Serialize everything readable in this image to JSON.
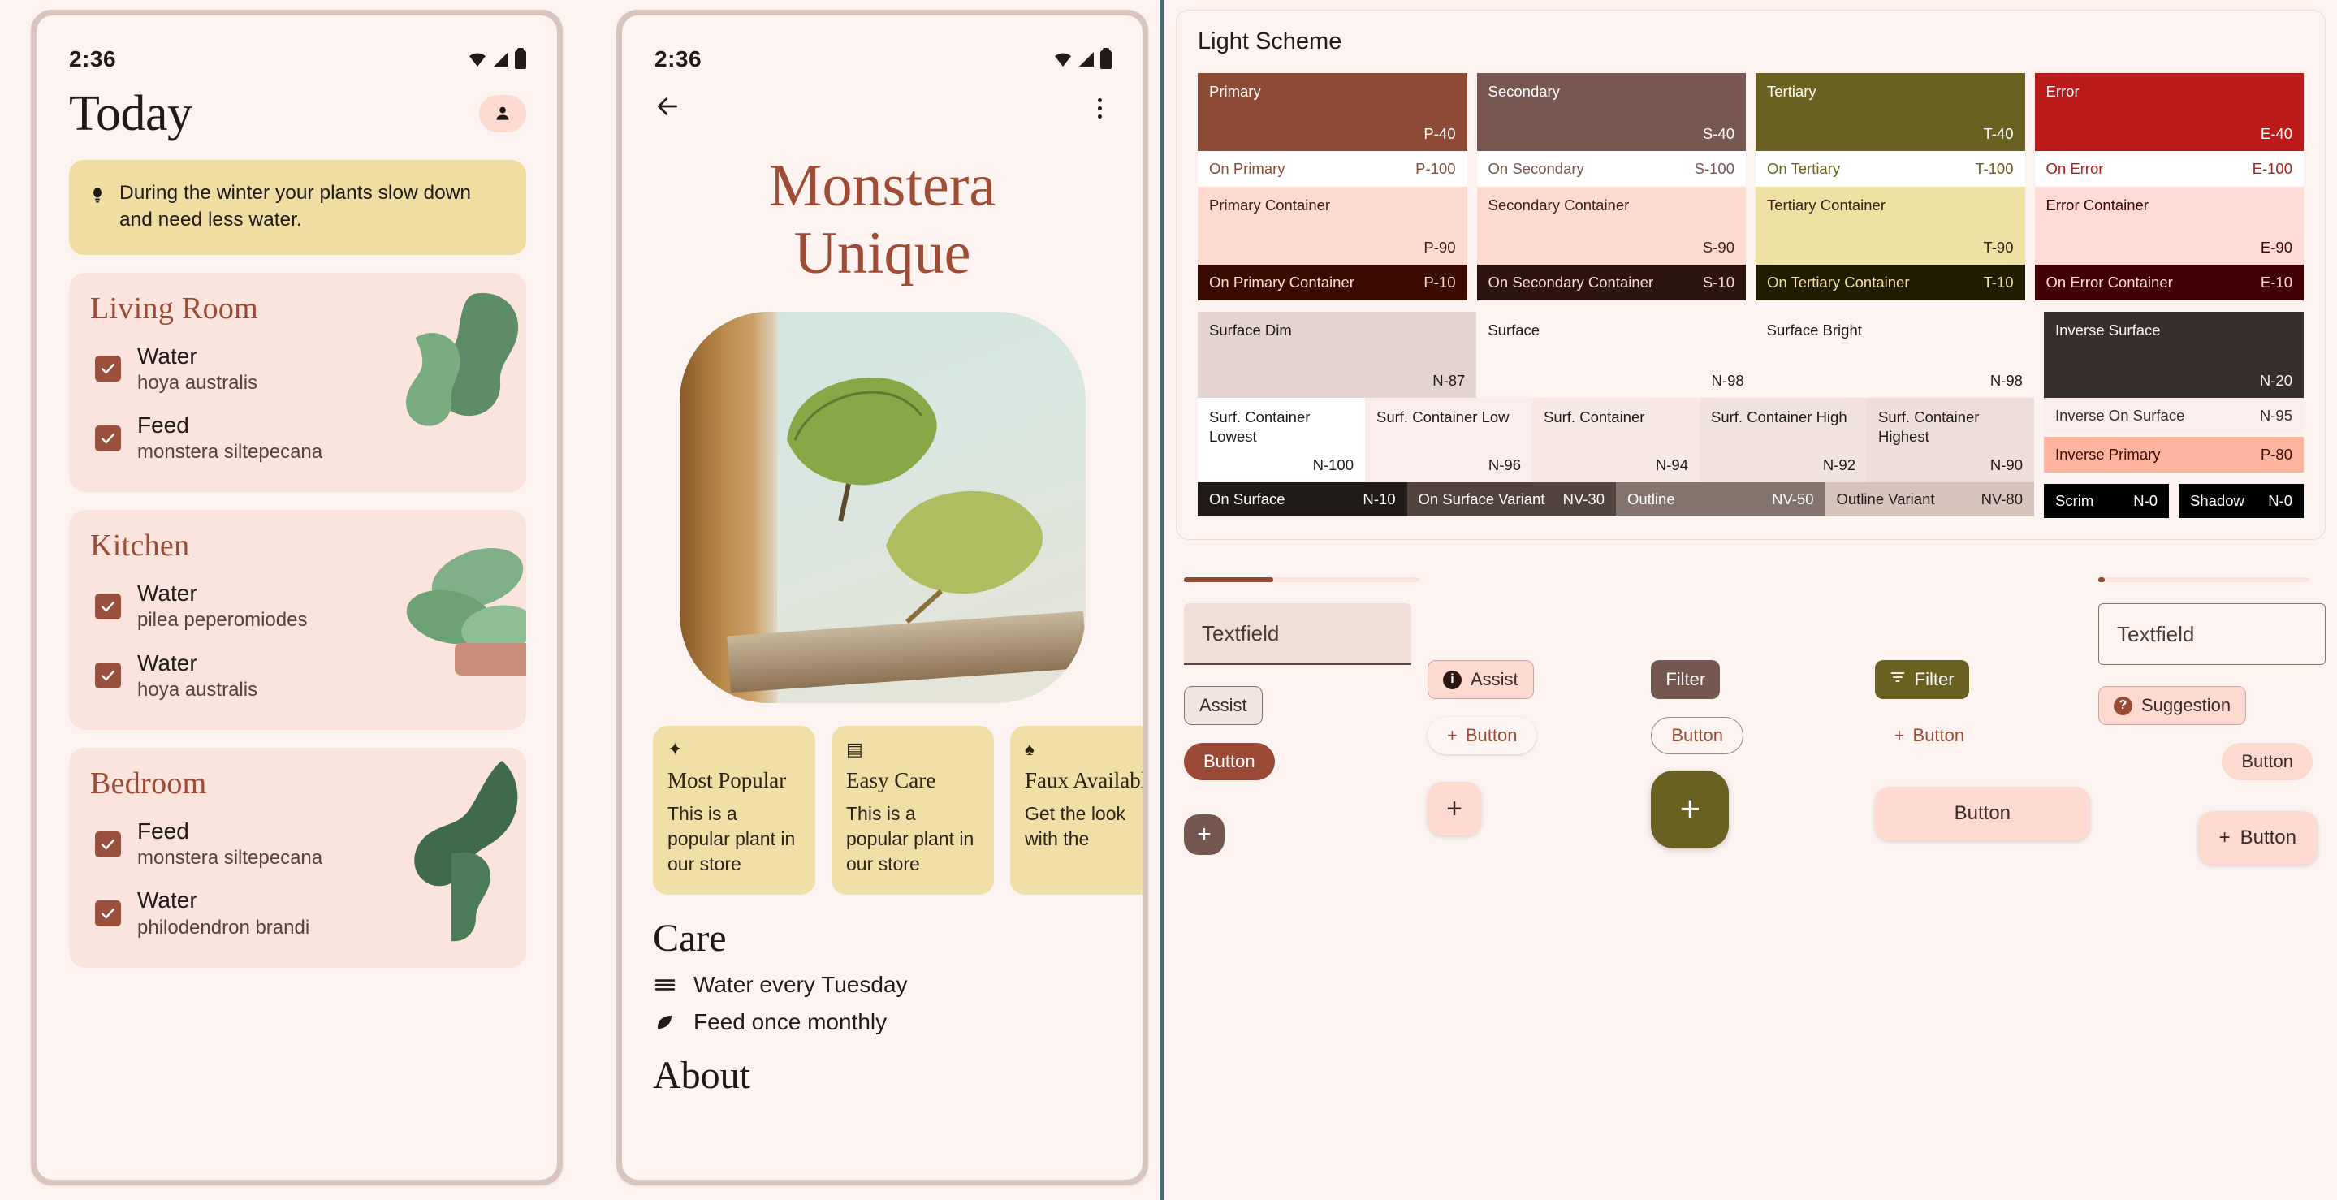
{
  "phone1": {
    "status": {
      "time": "2:36",
      "icons": [
        "wifi-icon",
        "signal-icon",
        "battery-icon"
      ]
    },
    "page_title": "Today",
    "avatar_label": "person-icon",
    "tip": {
      "icon": "lightbulb-icon",
      "text": "During the winter your plants slow down and need less water."
    },
    "rooms": [
      {
        "name": "Living Room",
        "tasks": [
          {
            "action": "Water",
            "plant": "hoya australis",
            "checked": true
          },
          {
            "action": "Feed",
            "plant": "monstera siltepecana",
            "checked": true
          }
        ]
      },
      {
        "name": "Kitchen",
        "tasks": [
          {
            "action": "Water",
            "plant": "pilea peperomiodes",
            "checked": true
          },
          {
            "action": "Water",
            "plant": "hoya australis",
            "checked": true
          }
        ]
      },
      {
        "name": "Bedroom",
        "tasks": [
          {
            "action": "Feed",
            "plant": "monstera siltepecana",
            "checked": true
          },
          {
            "action": "Water",
            "plant": "philodendron brandi",
            "checked": true
          }
        ]
      }
    ]
  },
  "phone2": {
    "status": {
      "time": "2:36"
    },
    "back_icon": "back-arrow-icon",
    "overflow_icon": "more-vert-icon",
    "title_line1": "Monstera",
    "title_line2": "Unique",
    "hero_alt": "monstera-plant-photo",
    "chips": [
      {
        "icon": "sparkle-icon",
        "title": "Most Popular",
        "body": "This is a popular plant in our store"
      },
      {
        "icon": "clipboard-icon",
        "title": "Easy Care",
        "body": "This is a popular plant in our store"
      },
      {
        "icon": "tree-icon",
        "title": "Faux Available",
        "body": "Get the look with the"
      }
    ],
    "care_heading": "Care",
    "care_items": [
      {
        "icon": "water-icon",
        "text": "Water every Tuesday"
      },
      {
        "icon": "leaf-icon",
        "text": "Feed once monthly"
      }
    ],
    "about_heading": "About"
  },
  "scheme": {
    "title": "Light Scheme",
    "columns": [
      {
        "main": {
          "label": "Primary",
          "token": "P-40",
          "bg": "#8d4a35",
          "fg": "#ffffff"
        },
        "on_main": {
          "label": "On Primary",
          "token": "P-100",
          "bg": "#ffffff",
          "fg": "#8d4a35"
        },
        "container": {
          "label": "Primary Container",
          "token": "P-90",
          "bg": "#ffdad1",
          "fg": "#3a2019"
        },
        "on_container": {
          "label": "On Primary Container",
          "token": "P-10",
          "bg": "#3a0b00",
          "fg": "#ffdad1"
        }
      },
      {
        "main": {
          "label": "Secondary",
          "token": "S-40",
          "bg": "#77574f",
          "fg": "#ffffff"
        },
        "on_main": {
          "label": "On Secondary",
          "token": "S-100",
          "bg": "#ffffff",
          "fg": "#77574f"
        },
        "container": {
          "label": "Secondary Container",
          "token": "S-90",
          "bg": "#ffdad1",
          "fg": "#3a2019"
        },
        "on_container": {
          "label": "On Secondary Container",
          "token": "S-10",
          "bg": "#2c1510",
          "fg": "#ffdad1"
        }
      },
      {
        "main": {
          "label": "Tertiary",
          "token": "T-40",
          "bg": "#6a6022",
          "fg": "#ffffff"
        },
        "on_main": {
          "label": "On Tertiary",
          "token": "T-100",
          "bg": "#ffffff",
          "fg": "#6a6022"
        },
        "container": {
          "label": "Tertiary Container",
          "token": "T-90",
          "bg": "#efe0a4",
          "fg": "#3a2019"
        },
        "on_container": {
          "label": "On Tertiary Container",
          "token": "T-10",
          "bg": "#201c00",
          "fg": "#efe0a4"
        }
      },
      {
        "main": {
          "label": "Error",
          "token": "E-40",
          "bg": "#ba1a1a",
          "fg": "#ffffff"
        },
        "on_main": {
          "label": "On Error",
          "token": "E-100",
          "bg": "#ffffff",
          "fg": "#ba1a1a"
        },
        "container": {
          "label": "Error Container",
          "token": "E-90",
          "bg": "#ffdad6",
          "fg": "#410002"
        },
        "on_container": {
          "label": "On Error Container",
          "token": "E-10",
          "bg": "#410002",
          "fg": "#ffdad6"
        }
      }
    ],
    "surfaces_row1": [
      {
        "label": "Surface Dim",
        "token": "N-87",
        "bg": "#e5d3cf",
        "fg": "#201a18"
      },
      {
        "label": "Surface",
        "token": "N-98",
        "bg": "#fdf4f2",
        "fg": "#201a18"
      },
      {
        "label": "Surface Bright",
        "token": "N-98",
        "bg": "#fdf4f2",
        "fg": "#201a18"
      }
    ],
    "surfaces_row2": [
      {
        "label": "Surf. Container Lowest",
        "token": "N-100",
        "bg": "#ffffff",
        "fg": "#201a18"
      },
      {
        "label": "Surf. Container Low",
        "token": "N-96",
        "bg": "#fbeeec",
        "fg": "#201a18"
      },
      {
        "label": "Surf. Container",
        "token": "N-94",
        "bg": "#f8e9e6",
        "fg": "#201a18"
      },
      {
        "label": "Surf. Container High",
        "token": "N-92",
        "bg": "#f3e3e0",
        "fg": "#201a18"
      },
      {
        "label": "Surf. Container Highest",
        "token": "N-90",
        "bg": "#eeddda",
        "fg": "#201a18"
      }
    ],
    "surfaces_row3": [
      {
        "label": "On Surface",
        "token": "N-10",
        "bg": "#201a18",
        "fg": "#ffffff"
      },
      {
        "label": "On Surface Variant",
        "token": "NV-30",
        "bg": "#53433f",
        "fg": "#ffffff"
      },
      {
        "label": "Outline",
        "token": "NV-50",
        "bg": "#85736e",
        "fg": "#ffffff"
      },
      {
        "label": "Outline Variant",
        "token": "NV-80",
        "bg": "#d8c2bc",
        "fg": "#201a18"
      }
    ],
    "inverse": [
      {
        "label": "Inverse Surface",
        "token": "N-20",
        "bg": "#362f2d",
        "fg": "#fbeeec"
      },
      {
        "label": "Inverse On Surface",
        "token": "N-95",
        "bg": "#fbeeec",
        "fg": "#362f2d"
      },
      {
        "label": "Inverse Primary",
        "token": "P-80",
        "bg": "#ffb4a0",
        "fg": "#3a0b00"
      }
    ],
    "scrim": {
      "label": "Scrim",
      "token": "N-0",
      "bg": "#000000",
      "fg": "#ffffff"
    },
    "shadow": {
      "label": "Shadow",
      "token": "N-0",
      "bg": "#000000",
      "fg": "#ffffff"
    }
  },
  "components": {
    "slider_left_value": 38,
    "slider_right_value": 3,
    "textfield_filled": {
      "value": "Textfield"
    },
    "textfield_outlined": {
      "value": "Textfield"
    },
    "chips": {
      "assist_outlined": "Assist",
      "assist_elevated": "Assist",
      "filter_secondary": "Filter",
      "filter_tertiary": "Filter",
      "suggestion": "Suggestion"
    },
    "buttons": {
      "filled": "Button",
      "elevated": "Button",
      "outlined": "Button",
      "text": "Button",
      "tonal": "Button"
    },
    "fabs": {
      "small": "+",
      "standard": "+",
      "large": "+",
      "tonal_label": "Button",
      "extended_label": "Button"
    }
  }
}
